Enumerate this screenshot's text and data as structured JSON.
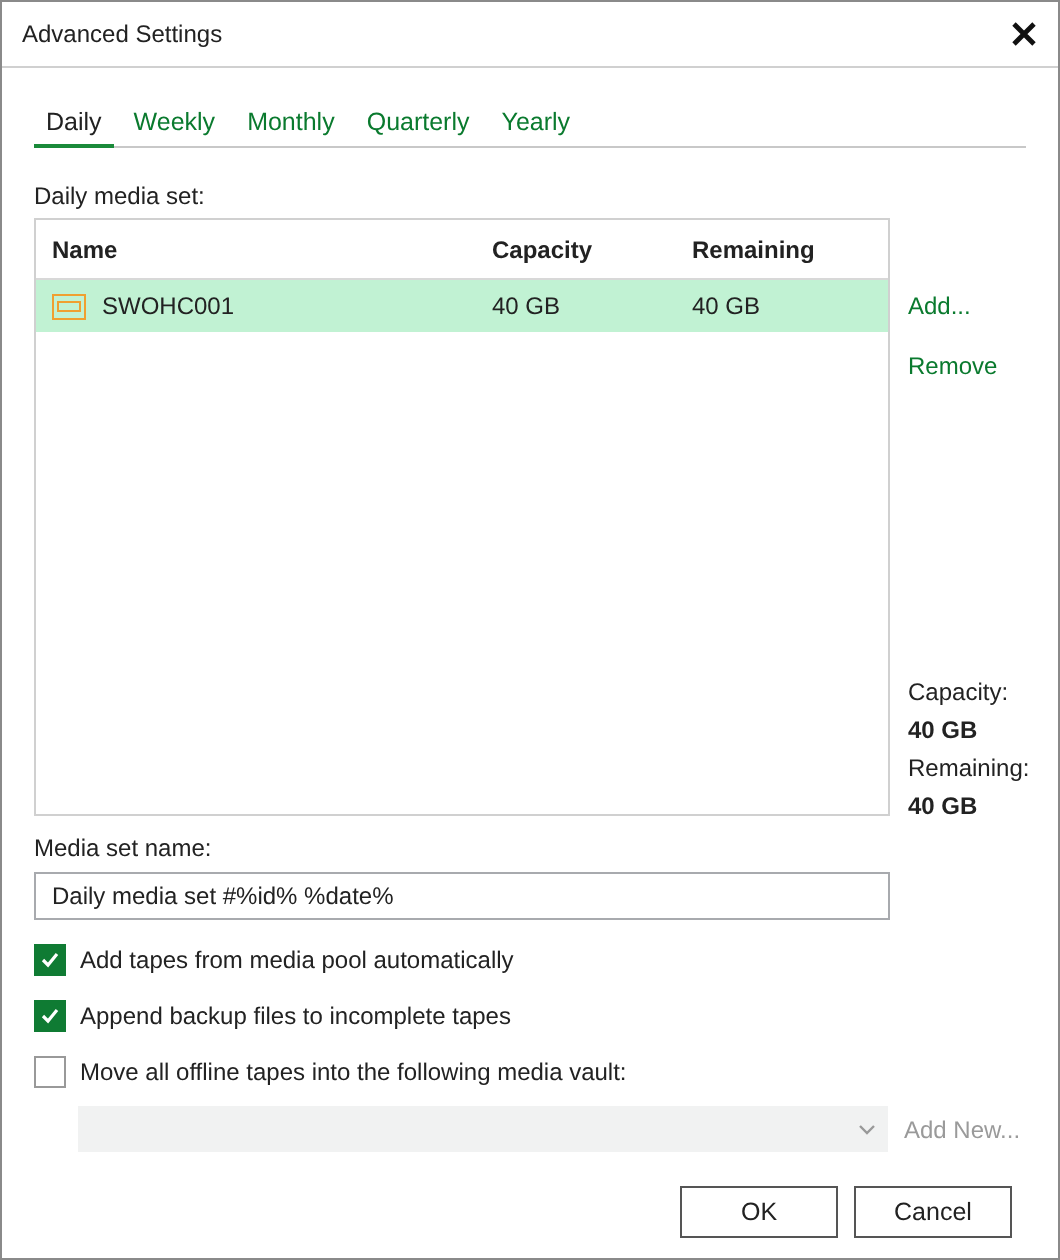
{
  "window": {
    "title": "Advanced Settings"
  },
  "tabs": [
    {
      "label": "Daily",
      "selected": true
    },
    {
      "label": "Weekly",
      "selected": false
    },
    {
      "label": "Monthly",
      "selected": false
    },
    {
      "label": "Quarterly",
      "selected": false
    },
    {
      "label": "Yearly",
      "selected": false
    }
  ],
  "media_set_label": "Daily media set:",
  "table": {
    "columns": [
      "Name",
      "Capacity",
      "Remaining"
    ],
    "rows": [
      {
        "name": "SWOHC001",
        "capacity": "40 GB",
        "remaining": "40 GB",
        "selected": true
      }
    ]
  },
  "side_links": [
    "Add...",
    "Remove"
  ],
  "summary": [
    {
      "label": "Capacity:",
      "value": "40 GB"
    },
    {
      "label": "Remaining:",
      "value": "40 GB"
    }
  ],
  "media_set_name": {
    "label": "Media set name:",
    "value": "Daily media set #%id% %date%"
  },
  "options": [
    {
      "label": "Add tapes from media pool automatically",
      "checked": true
    },
    {
      "label": "Append backup files to incomplete tapes",
      "checked": true
    },
    {
      "label": "Move all offline tapes into the following media vault:",
      "checked": false
    }
  ],
  "vault": {
    "disabled": true,
    "add_new": "Add New..."
  },
  "buttons": [
    "OK",
    "Cancel"
  ]
}
